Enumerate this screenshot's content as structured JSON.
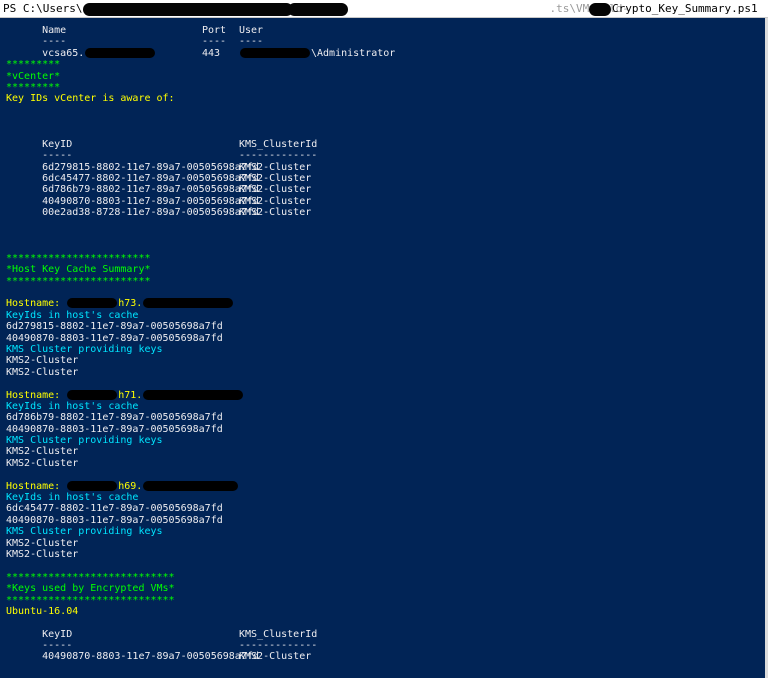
{
  "window": {
    "title_prefix": "PS C:\\Users\\",
    "title_partial": ".ts\\VMworld-",
    "title_suffix": "Crypto_Key_Summary.ps1"
  },
  "connection": {
    "headers": [
      "Name",
      "Port",
      "User"
    ],
    "underlines": [
      "----",
      "----",
      "----"
    ],
    "server_prefix": "vcsa65.",
    "port": "443",
    "user_suffix": "\\Administrator"
  },
  "vcenter": {
    "stars": "*********",
    "title": "*vCenter*",
    "heading": "Key IDs vCenter is aware of:",
    "headers": [
      "KeyID",
      "KMS_ClusterId"
    ],
    "underlines": [
      "-----",
      "-------------"
    ],
    "rows": [
      {
        "key_id": "6d279815-8802-11e7-89a7-00505698a7fd",
        "cluster": "KMS2-Cluster"
      },
      {
        "key_id": "6dc45477-8802-11e7-89a7-00505698a7fd",
        "cluster": "KMS2-Cluster"
      },
      {
        "key_id": "6d786b79-8802-11e7-89a7-00505698a7fd",
        "cluster": "KMS2-Cluster"
      },
      {
        "key_id": "40490870-8803-11e7-89a7-00505698a7fd",
        "cluster": "KMS2-Cluster"
      },
      {
        "key_id": "00e2ad38-8728-11e7-89a7-00505698a7fd",
        "cluster": "KMS2-Cluster"
      }
    ]
  },
  "host_cache": {
    "stars": "************************",
    "title": "*Host Key Cache Summary*",
    "keyids_label": "KeyIds in host's cache",
    "kms_label": "KMS Cluster providing keys",
    "hosts": [
      {
        "hostname_label": "Hostname:",
        "hostname_fragment": "h73.",
        "keys": [
          "6d279815-8802-11e7-89a7-00505698a7fd",
          "40490870-8803-11e7-89a7-00505698a7fd"
        ],
        "clusters": [
          "KMS2-Cluster",
          "KMS2-Cluster"
        ]
      },
      {
        "hostname_label": "Hostname:",
        "hostname_fragment": "h71.",
        "keys": [
          "6d786b79-8802-11e7-89a7-00505698a7fd",
          "40490870-8803-11e7-89a7-00505698a7fd"
        ],
        "clusters": [
          "KMS2-Cluster",
          "KMS2-Cluster"
        ]
      },
      {
        "hostname_label": "Hostname:",
        "hostname_fragment": "h69.",
        "keys": [
          "6dc45477-8802-11e7-89a7-00505698a7fd",
          "40490870-8803-11e7-89a7-00505698a7fd"
        ],
        "clusters": [
          "KMS2-Cluster",
          "KMS2-Cluster"
        ]
      }
    ]
  },
  "encrypted_vms": {
    "stars": "****************************",
    "title": "*Keys used by Encrypted VMs*",
    "vm_name": "Ubuntu-16.04",
    "headers": [
      "KeyID",
      "KMS_ClusterId"
    ],
    "underlines": [
      "-----",
      "-------------"
    ],
    "rows": [
      {
        "key_id": "40490870-8803-11e7-89a7-00505698a7fd",
        "cluster": "KMS2-Cluster"
      }
    ]
  },
  "colors": {
    "background": "#012456",
    "text": "#eeedf0",
    "heading_yellow": "#ffff00",
    "banner_green": "#00ff00",
    "label_cyan": "#00e5ff"
  }
}
